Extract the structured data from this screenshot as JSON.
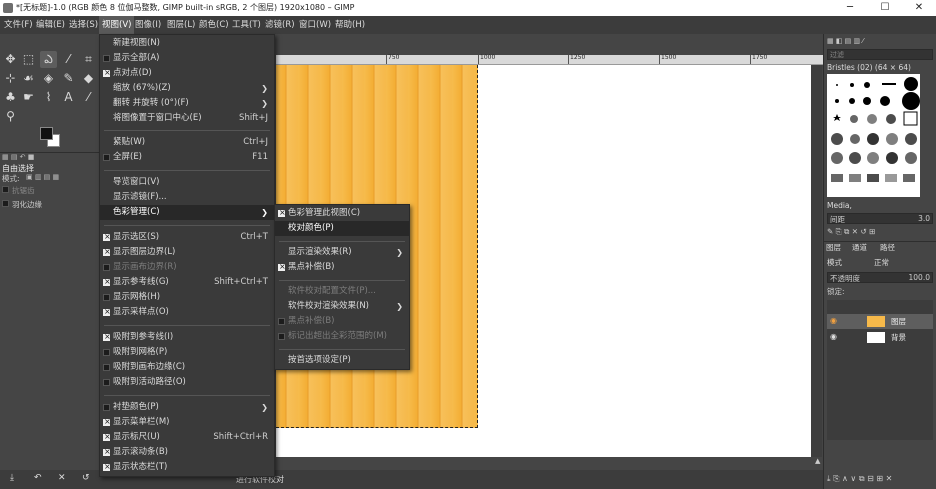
{
  "window": {
    "title": "*[无标题]-1.0 (RGB 颜色 8 位伽马整数, GIMP built-in sRGB, 2 个图层) 1920x1080 – GIMP",
    "minimize": "─",
    "maximize": "☐",
    "close": "✕"
  },
  "menubar": [
    "文件(F)",
    "编辑(E)",
    "选择(S)",
    "视图(V)",
    "图像(I)",
    "图层(L)",
    "颜色(C)",
    "工具(T)",
    "滤镜(R)",
    "窗口(W)",
    "帮助(H)"
  ],
  "toolbox": {
    "tool_name": "自由选择",
    "mode_label": "模式:",
    "antialias": "抗锯齿",
    "feather": "羽化边缘"
  },
  "ruler": [
    "750",
    "1000",
    "1250",
    "1500",
    "1750"
  ],
  "statusbar": {
    "message": "进行软件校对"
  },
  "view_menu": [
    {
      "label": "新建视图(N)"
    },
    {
      "label": "显示全部(A)",
      "check": false
    },
    {
      "label": "点对点(D)",
      "check": true
    },
    {
      "label": "缩放 (67%)(Z)",
      "arrow": true
    },
    {
      "label": "翻转 并旋转 (0°)(F)",
      "arrow": true
    },
    {
      "label": "将图像置于窗口中心(E)",
      "shortcut": "Shift+J"
    },
    {
      "label": "紧贴(W)",
      "shortcut": "Ctrl+J"
    },
    {
      "label": "全屏(E)",
      "shortcut": "F11",
      "check": false
    },
    {
      "label": "导览窗口(V)"
    },
    {
      "label": "显示滤镜(F)..."
    },
    {
      "label": "色彩管理(C)",
      "arrow": true,
      "highlight": true
    },
    {
      "label": "显示选区(S)",
      "shortcut": "Ctrl+T",
      "check": true
    },
    {
      "label": "显示图层边界(L)",
      "check": true
    },
    {
      "label": "显示画布边界(R)",
      "check": false,
      "disabled": true
    },
    {
      "label": "显示参考线(G)",
      "shortcut": "Shift+Ctrl+T",
      "check": true
    },
    {
      "label": "显示网格(H)",
      "check": false
    },
    {
      "label": "显示采样点(O)",
      "check": true
    },
    {
      "label": "吸附到参考线(I)",
      "check": true
    },
    {
      "label": "吸附到网格(P)",
      "check": false
    },
    {
      "label": "吸附到画布边缘(C)",
      "check": false
    },
    {
      "label": "吸附到活动路径(O)",
      "check": false
    },
    {
      "label": "衬垫颜色(P)",
      "arrow": true
    },
    {
      "label": "显示菜单栏(M)",
      "check": true
    },
    {
      "label": "显示标尺(U)",
      "shortcut": "Shift+Ctrl+R",
      "check": true
    },
    {
      "label": "显示滚动条(B)",
      "check": true
    },
    {
      "label": "显示状态栏(T)",
      "check": true
    }
  ],
  "color_menu": [
    {
      "label": "色彩管理此视图(C)",
      "check": true
    },
    {
      "label": "校对颜色(P)",
      "highlight": true
    },
    {
      "label": "显示渲染效果(R)",
      "arrow": true
    },
    {
      "label": "黑点补偿(B)",
      "check": true
    },
    {
      "label": "软件校对配置文件(P)...",
      "disabled": true
    },
    {
      "label": "软件校对渲染效果(N)",
      "arrow": true
    },
    {
      "label": "黑点补偿(B)",
      "check": false,
      "disabled": true
    },
    {
      "label": "标记出超出全彩范围的(M)",
      "check": false,
      "disabled": true
    },
    {
      "label": "按首选项设定(P)"
    }
  ],
  "right": {
    "brushes_filter": "过滤",
    "brush_name": "Bristles (02) (64 × 64)",
    "tag": "Media,",
    "spacing_label": "间距",
    "spacing": "3.0",
    "tab_layers": "图层",
    "tab_channels": "通道",
    "tab_paths": "路径",
    "mode_label": "模式",
    "mode_value": "正常",
    "opacity_label": "不透明度",
    "opacity_value": "100.0",
    "lock_label": "锁定:",
    "layers": [
      {
        "name": "图层"
      },
      {
        "name": "背景"
      }
    ]
  }
}
